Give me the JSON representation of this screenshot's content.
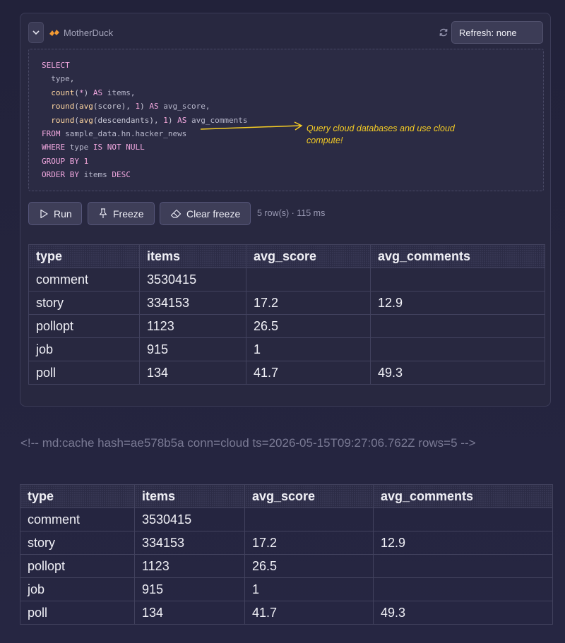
{
  "toolbar": {
    "connection_name": "MotherDuck",
    "refresh_label": "Refresh: none"
  },
  "editor": {
    "lines": [
      [
        {
          "t": "SELECT",
          "c": "kw"
        }
      ],
      [
        {
          "t": "  "
        },
        {
          "t": "type",
          "c": "id"
        },
        {
          "t": ","
        }
      ],
      [
        {
          "t": "  "
        },
        {
          "t": "count",
          "c": "fn"
        },
        {
          "t": "("
        },
        {
          "t": "*",
          "c": "kw"
        },
        {
          "t": ") "
        },
        {
          "t": "AS",
          "c": "kw"
        },
        {
          "t": " items,",
          "c": "id"
        }
      ],
      [
        {
          "t": "  "
        },
        {
          "t": "round",
          "c": "fn"
        },
        {
          "t": "("
        },
        {
          "t": "avg",
          "c": "fn"
        },
        {
          "t": "(score), "
        },
        {
          "t": "1",
          "c": "num"
        },
        {
          "t": ") "
        },
        {
          "t": "AS",
          "c": "kw"
        },
        {
          "t": " avg_score,",
          "c": "id"
        }
      ],
      [
        {
          "t": "  "
        },
        {
          "t": "round",
          "c": "fn"
        },
        {
          "t": "("
        },
        {
          "t": "avg",
          "c": "fn"
        },
        {
          "t": "(descendants), "
        },
        {
          "t": "1",
          "c": "num"
        },
        {
          "t": ") "
        },
        {
          "t": "AS",
          "c": "kw"
        },
        {
          "t": " avg_comments",
          "c": "id"
        }
      ],
      [
        {
          "t": "FROM",
          "c": "kw"
        },
        {
          "t": " sample_data.hn.hacker_news",
          "c": "id"
        }
      ],
      [
        {
          "t": "WHERE",
          "c": "kw"
        },
        {
          "t": " type ",
          "c": "id"
        },
        {
          "t": "IS NOT NULL",
          "c": "kw"
        }
      ],
      [
        {
          "t": "GROUP BY",
          "c": "kw"
        },
        {
          "t": " "
        },
        {
          "t": "1",
          "c": "num"
        }
      ],
      [
        {
          "t": "ORDER BY",
          "c": "kw"
        },
        {
          "t": " items ",
          "c": "id"
        },
        {
          "t": "DESC",
          "c": "kw"
        }
      ]
    ],
    "annotation": "Query cloud databases and use cloud compute!"
  },
  "actions": {
    "run_label": "Run",
    "freeze_label": "Freeze",
    "clear_freeze_label": "Clear freeze",
    "meta": "5 row(s) · 115 ms"
  },
  "results": {
    "columns": [
      "type",
      "items",
      "avg_score",
      "avg_comments"
    ],
    "rows": [
      [
        "comment",
        "3530415",
        "",
        ""
      ],
      [
        "story",
        "334153",
        "17.2",
        "12.9"
      ],
      [
        "pollopt",
        "1123",
        "26.5",
        ""
      ],
      [
        "job",
        "915",
        "1",
        ""
      ],
      [
        "poll",
        "134",
        "41.7",
        "49.3"
      ]
    ]
  },
  "cache_comment": "<!-- md:cache hash=ae578b5a conn=cloud ts=2026-05-15T09:27:06.762Z rows=5 -->",
  "rendered": {
    "columns": [
      "type",
      "items",
      "avg_score",
      "avg_comments"
    ],
    "rows": [
      [
        "comment",
        "3530415",
        "",
        ""
      ],
      [
        "story",
        "334153",
        "17.2",
        "12.9"
      ],
      [
        "pollopt",
        "1123",
        "26.5",
        ""
      ],
      [
        "job",
        "915",
        "1",
        ""
      ],
      [
        "poll",
        "134",
        "41.7",
        "49.3"
      ]
    ]
  },
  "colors": {
    "background": "#22223a",
    "card": "#282840",
    "annotation": "#f5cc24",
    "keyword": "#f2a8e0",
    "function": "#ffd6a0"
  }
}
